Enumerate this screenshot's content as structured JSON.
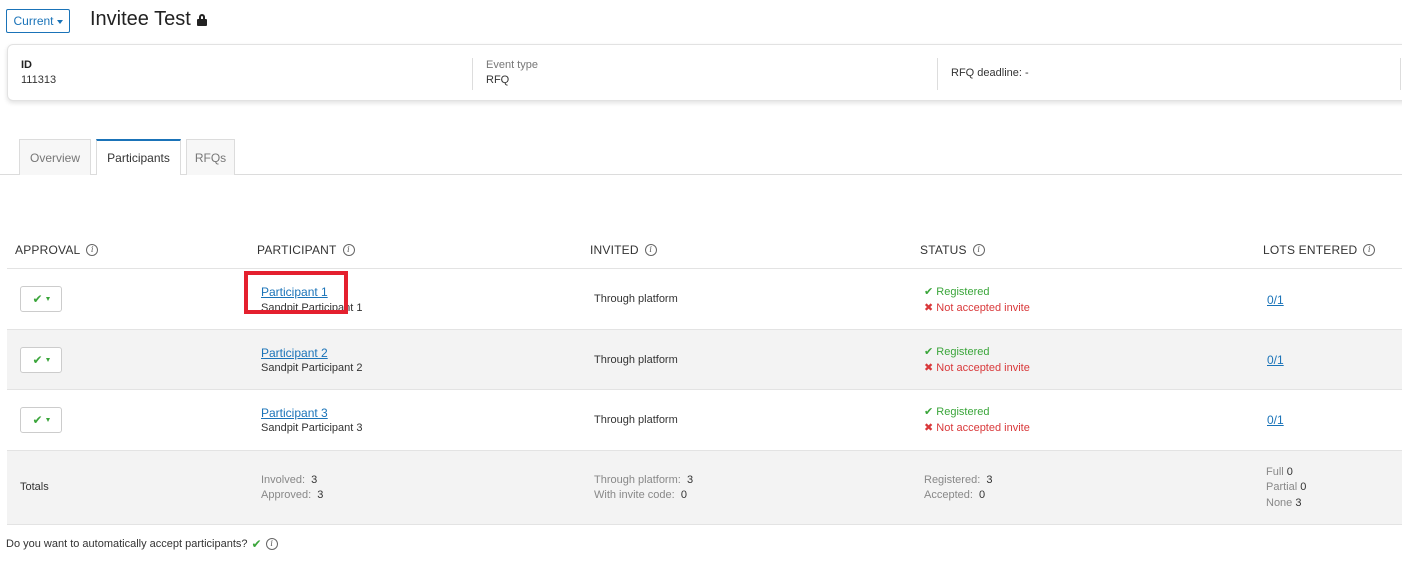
{
  "header": {
    "view_label": "Current",
    "title": "Invitee Test"
  },
  "info": {
    "id_label": "ID",
    "id_value": "111313",
    "event_type_label": "Event type",
    "event_type_value": "RFQ",
    "deadline_text": "RFQ deadline: -"
  },
  "tabs": [
    {
      "label": "Overview",
      "active": false
    },
    {
      "label": "Participants",
      "active": true
    },
    {
      "label": "RFQs",
      "active": false
    }
  ],
  "columns": {
    "approval": "APPROVAL",
    "participant": "PARTICIPANT",
    "invited": "INVITED",
    "status": "STATUS",
    "lots": "LOTS ENTERED"
  },
  "rows": [
    {
      "name": "Participant 1",
      "org": "Sandpit Participant 1",
      "invited": "Through platform",
      "status_ok": "Registered",
      "status_no": "Not accepted invite",
      "lots": "0/1"
    },
    {
      "name": "Participant 2",
      "org": "Sandpit Participant 2",
      "invited": "Through platform",
      "status_ok": "Registered",
      "status_no": "Not accepted invite",
      "lots": "0/1"
    },
    {
      "name": "Participant 3",
      "org": "Sandpit Participant 3",
      "invited": "Through platform",
      "status_ok": "Registered",
      "status_no": "Not accepted invite",
      "lots": "0/1"
    }
  ],
  "totals": {
    "label": "Totals",
    "involved_label": "Involved:",
    "involved": "3",
    "approved_label": "Approved:",
    "approved": "3",
    "through_platform_label": "Through platform:",
    "through_platform": "3",
    "invite_code_label": "With invite code:",
    "invite_code": "0",
    "registered_label": "Registered:",
    "registered": "3",
    "accepted_label": "Accepted:",
    "accepted": "0",
    "full_label": "Full",
    "full": "0",
    "partial_label": "Partial",
    "partial": "0",
    "none_label": "None",
    "none": "3"
  },
  "footer": {
    "question": "Do you want to automatically accept participants?"
  },
  "colors": {
    "accent": "#1a73b8",
    "success": "#3aa53a",
    "danger": "#d9383a",
    "highlight": "#e4202e"
  }
}
